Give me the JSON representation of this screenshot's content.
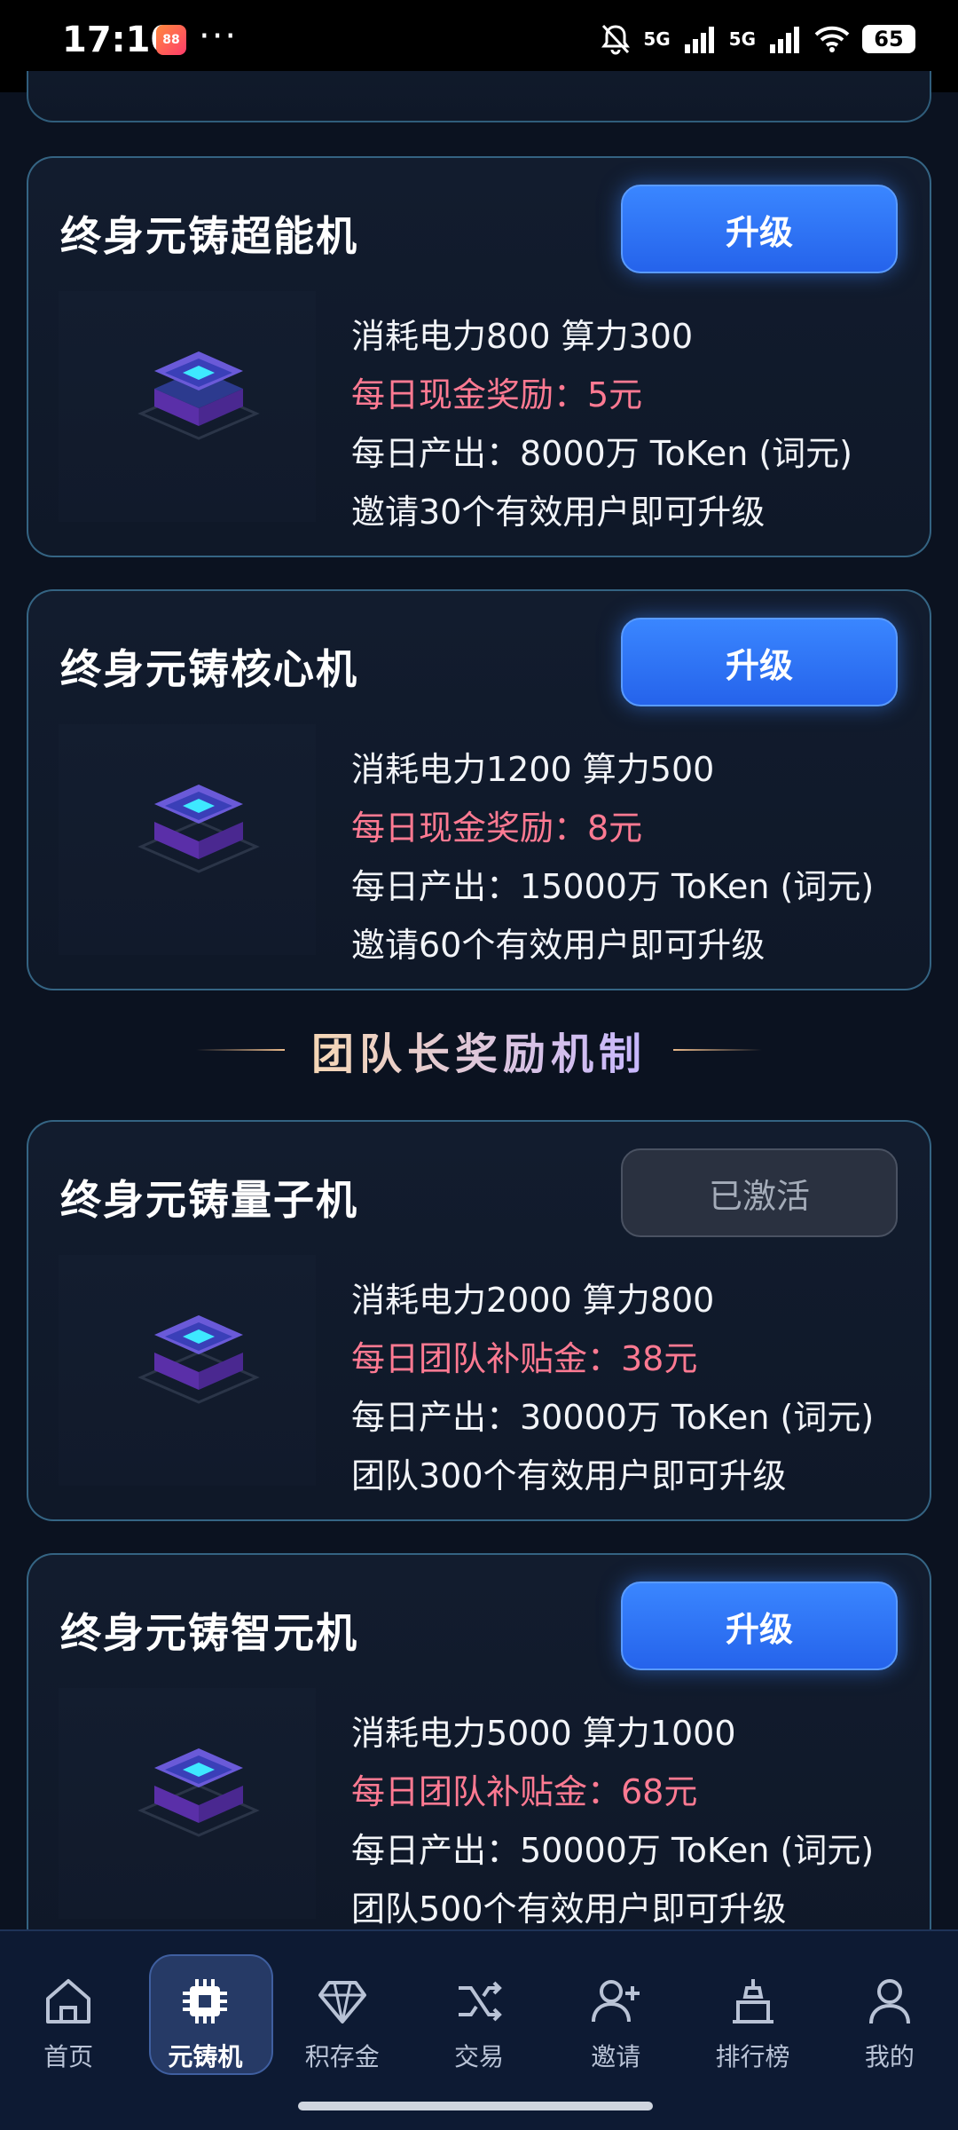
{
  "status_bar": {
    "time": "17:10",
    "app_badge": "88",
    "dots": "···",
    "signal_1": "5G",
    "signal_2": "5G",
    "battery": "65"
  },
  "cards": [
    {
      "title": "终身元铸超能机",
      "button": "升级",
      "button_state": "upgrade",
      "line1": "消耗电力800 算力300",
      "reward": "每日现金奖励：5元",
      "line3": "每日产出：8000万 ToKen (词元)",
      "line4": "邀请30个有效用户即可升级"
    },
    {
      "title": "终身元铸核心机",
      "button": "升级",
      "button_state": "upgrade",
      "line1": "消耗电力1200 算力500",
      "reward": "每日现金奖励：8元",
      "line3": "每日产出：15000万 ToKen (词元)",
      "line4": "邀请60个有效用户即可升级"
    },
    {
      "title": "终身元铸量子机",
      "button": "已激活",
      "button_state": "activated",
      "line1": "消耗电力2000 算力800",
      "reward": "每日团队补贴金：38元",
      "line3": "每日产出：30000万 ToKen (词元)",
      "line4": "团队300个有效用户即可升级"
    },
    {
      "title": "终身元铸智元机",
      "button": "升级",
      "button_state": "upgrade",
      "line1": "消耗电力5000 算力1000",
      "reward": "每日团队补贴金：68元",
      "line3": "每日产出：50000万 ToKen (词元)",
      "line4": "团队500个有效用户即可升级"
    }
  ],
  "section_title": "团队长奖励机制",
  "nav": [
    {
      "label": "首页",
      "icon": "home-icon"
    },
    {
      "label": "元铸机",
      "icon": "chip-icon",
      "active": true
    },
    {
      "label": "积存金",
      "icon": "diamond-icon"
    },
    {
      "label": "交易",
      "icon": "shuffle-icon"
    },
    {
      "label": "邀请",
      "icon": "add-user-icon"
    },
    {
      "label": "排行榜",
      "icon": "podium-icon"
    },
    {
      "label": "我的",
      "icon": "profile-icon"
    }
  ],
  "colors": {
    "background": "#0b1220",
    "accent_blue": "#3a86ff",
    "reward_pink": "#ff7a92",
    "nav_bg": "#0d1a33"
  }
}
